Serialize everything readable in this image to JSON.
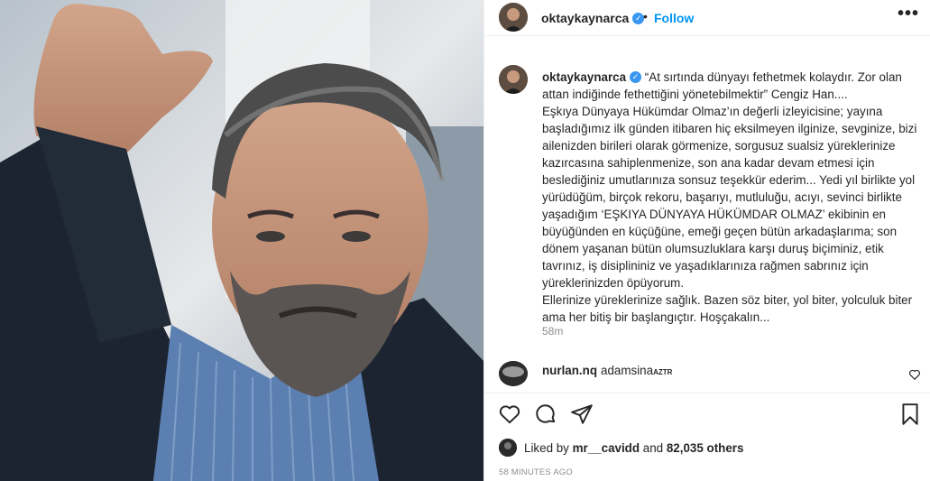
{
  "header": {
    "username": "oktaykaynarca",
    "separator": "•",
    "follow_label": "Follow",
    "more_label": "•••",
    "verified_glyph": "✓"
  },
  "caption": {
    "username": "oktaykaynarca",
    "lines": [
      "“At sırtında dünyayı fethetmek kolaydır. Zor olan attan indiğinde fethettiğini yönetebilmektir” Cengiz Han....",
      "Eşkıya Dünyaya Hükümdar Olmaz’ın değerli izleyicisine; yayına başladığımız ilk günden itibaren hiç eksilmeyen ilginize, sevginize, bizi ailenizden birileri olarak görmenize, sorgusuz sualsiz yüreklerinize kazırcasına sahiplenmenize, son ana kadar devam etmesi için beslediğiniz umutlarınıza sonsuz teşekkür ederim... Yedi yıl birlikte yol yürüdüğüm, birçok rekoru, başarıyı, mutluluğu, acıyı, sevinci birlikte yaşadığım ‘EŞKIYA DÜNYAYA HÜKÜMDAR OLMAZ’ ekibinin en büyüğünden en küçüğüne, emeği geçen bütün arkadaşlarıma; son dönem yaşanan bütün olumsuzluklara karşı duruş biçiminiz, etik tavrınız, iş disiplininiz ve yaşadıklarınıza rağmen sabrınız için yüreklerinizden öpüyorum.",
      "Ellerinize yüreklerinize sağlık. Bazen söz biter, yol biter, yolculuk biter ama her bitiş bir başlangıçtır. Hoşçakalın..."
    ],
    "time": "58m"
  },
  "comment": {
    "username": "nurlan.nq",
    "text": "adamsinа",
    "flag_text": "AZTR"
  },
  "likes": {
    "prefix": "Liked by",
    "user": "mr__cavidd",
    "middle": "and",
    "count": "82,035 others"
  },
  "post_time": "58 MINUTES AGO",
  "icons": {
    "like": "heart-icon",
    "comment": "comment-icon",
    "share": "send-icon",
    "save": "bookmark-icon",
    "comment_like": "small-heart-icon"
  },
  "colors": {
    "link_blue": "#0095f6",
    "verified_blue": "#3897f0",
    "muted": "#8e8e8e",
    "border": "#efefef"
  }
}
